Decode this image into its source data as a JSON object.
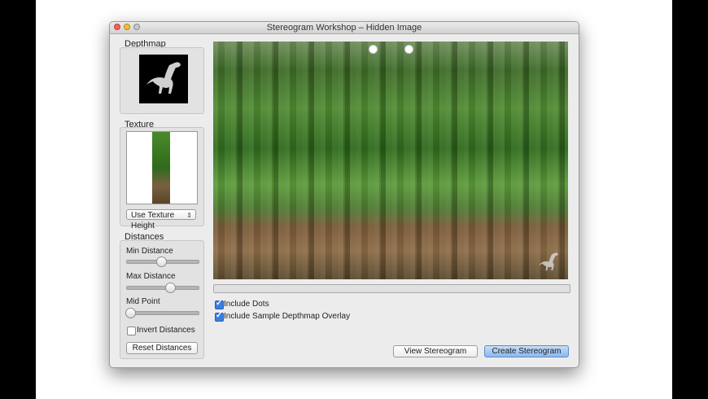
{
  "window": {
    "title": "Stereogram Workshop – Hidden Image"
  },
  "depthmap": {
    "label": "Depthmap"
  },
  "texture": {
    "label": "Texture",
    "height_mode": "Use Texture Height"
  },
  "distances": {
    "label": "Distances",
    "sliders": [
      {
        "label": "Min Distance",
        "value": 0.48
      },
      {
        "label": "Max Distance",
        "value": 0.6
      },
      {
        "label": "Mid Point",
        "value": 0.05
      }
    ],
    "invert_label": "Invert Distances",
    "invert_checked": false,
    "reset_label": "Reset Distances"
  },
  "options": {
    "include_dots_label": "Include Dots",
    "include_dots_checked": true,
    "include_overlay_label": "Include Sample Depthmap Overlay",
    "include_overlay_checked": true
  },
  "buttons": {
    "view": "View Stereogram",
    "create": "Create Stereogram"
  },
  "colors": {
    "close": "#ff5f57",
    "minimize": "#ffbd2e",
    "zoom": "#c8c8c8",
    "default_button": "#8ab8ee"
  }
}
